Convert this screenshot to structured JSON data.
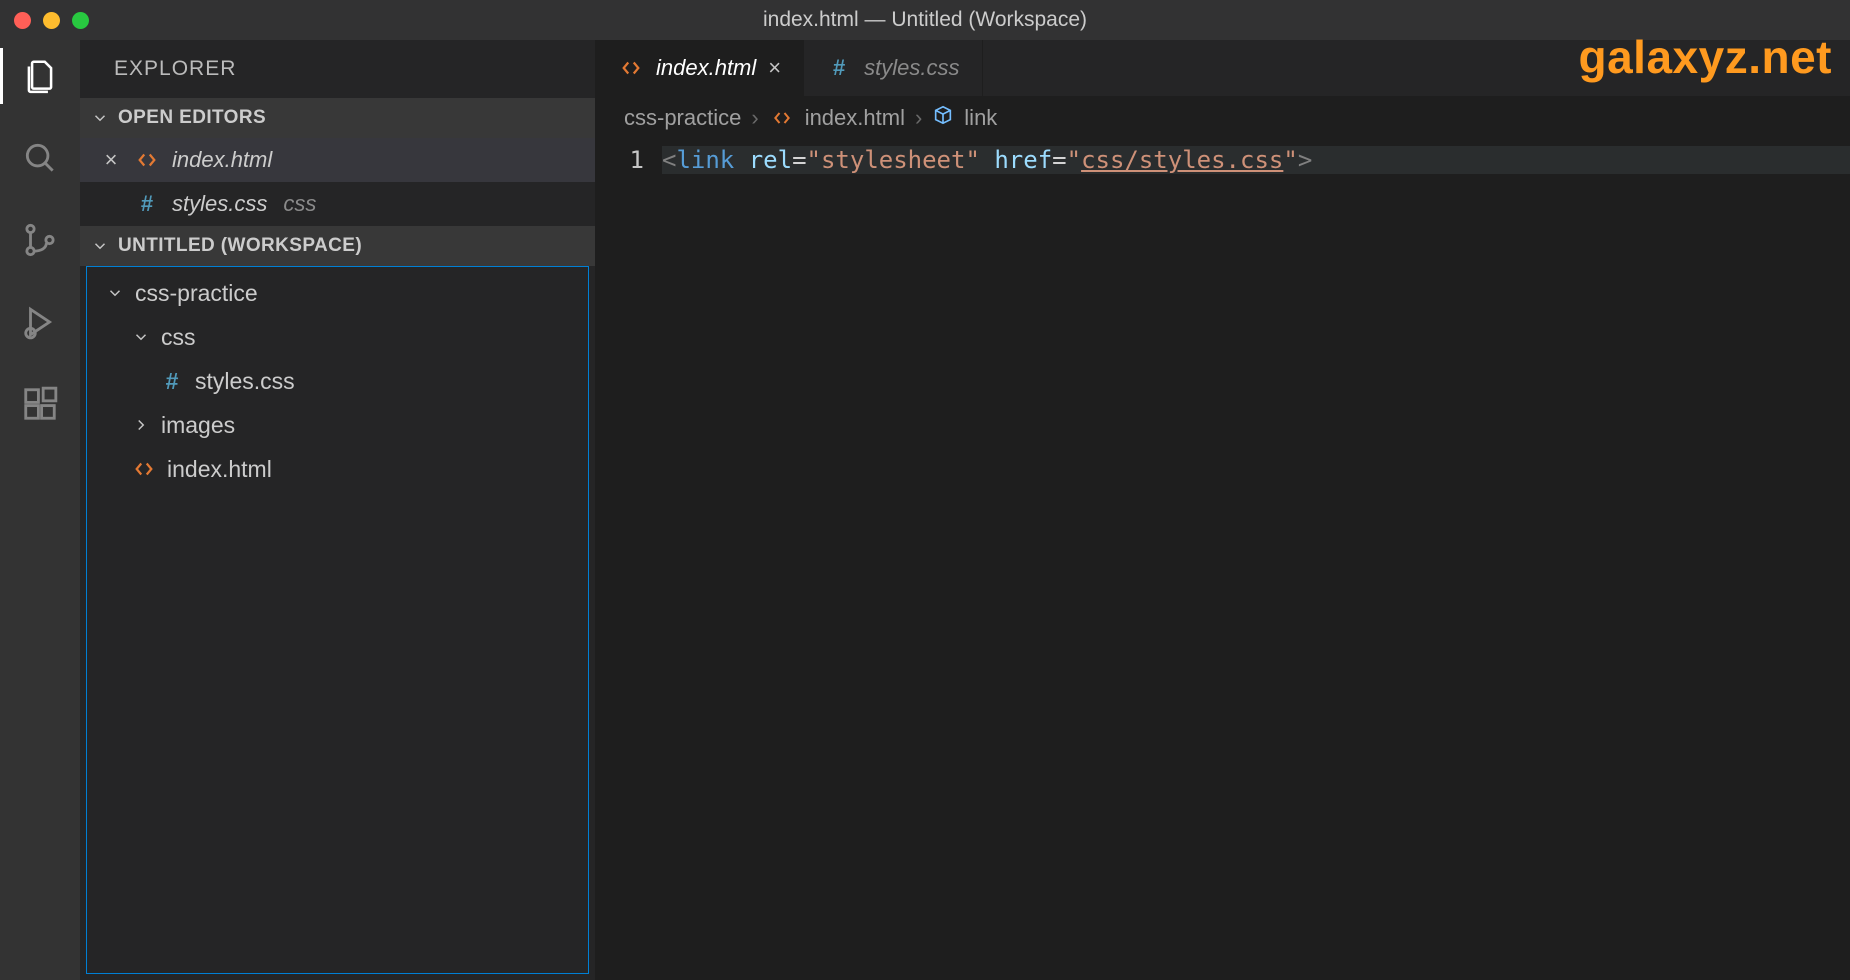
{
  "title": "index.html — Untitled (Workspace)",
  "watermark": "galaxyz.net",
  "sidebar": {
    "title": "EXPLORER",
    "openEditorsHeader": "OPEN EDITORS",
    "workspaceHeader": "UNTITLED (WORKSPACE)",
    "openEditors": [
      {
        "name": "index.html",
        "close": "×",
        "descr": ""
      },
      {
        "name": "styles.css",
        "close": "",
        "descr": "css"
      }
    ],
    "tree": {
      "root": "css-practice",
      "folder_css": "css",
      "file_styles": "styles.css",
      "folder_images": "images",
      "file_index": "index.html"
    }
  },
  "tabs": [
    {
      "name": "index.html",
      "active": true,
      "close": "×"
    },
    {
      "name": "styles.css",
      "active": false,
      "close": ""
    }
  ],
  "breadcrumbs": {
    "seg1": "css-practice",
    "seg2": "index.html",
    "seg3": "link",
    "sep": "›"
  },
  "code": {
    "lineNumber": "1",
    "open": "<",
    "tag": "link",
    "attr_rel": "rel",
    "val_rel": "\"stylesheet\"",
    "attr_href": "href",
    "val_href_q": "\"",
    "val_href": "css/styles.css",
    "close": ">"
  }
}
